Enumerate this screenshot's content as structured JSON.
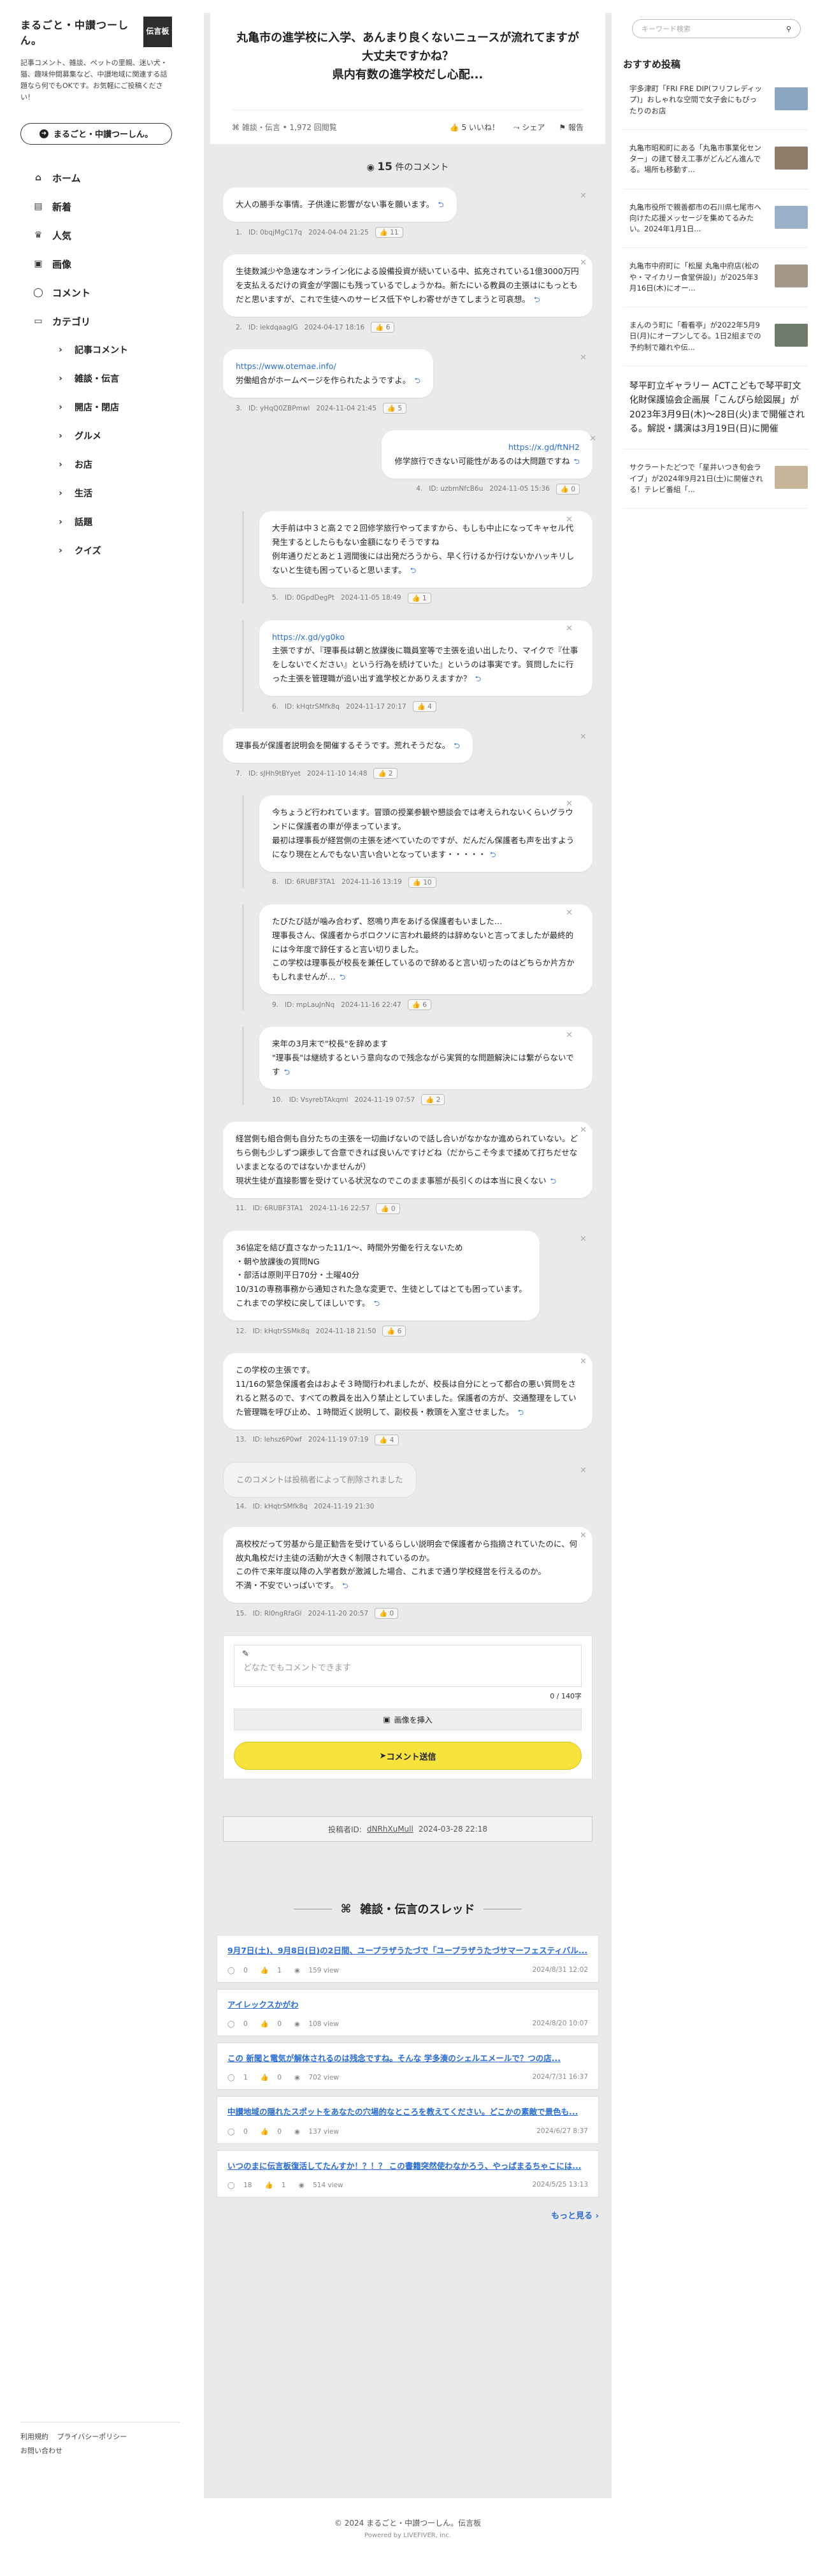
{
  "site": {
    "logo": "まるごと・中讃つーしん。",
    "badge": "伝言板",
    "description": "記事コメント、雑談、ペットの里親、迷い犬・猫、趣味仲間募集など、中讃地域に関連する話題なら何でもOKです。お気軽にご投稿ください！",
    "button_label": "まるごと・中讃つーしん。"
  },
  "nav": [
    {
      "label": "ホーム",
      "icon": "home-icon",
      "glyph": "⌂",
      "sub": false
    },
    {
      "label": "新着",
      "icon": "news-icon",
      "glyph": "▤",
      "sub": false
    },
    {
      "label": "人気",
      "icon": "popular-icon",
      "glyph": "♛",
      "sub": false
    },
    {
      "label": "画像",
      "icon": "image-icon",
      "glyph": "▣",
      "sub": false
    },
    {
      "label": "コメント",
      "icon": "comment-icon",
      "glyph": "◯",
      "sub": false
    },
    {
      "label": "カテゴリ",
      "icon": "folder-icon",
      "glyph": "▭",
      "sub": false
    },
    {
      "label": "記事コメント",
      "icon": "chevron-right-icon",
      "glyph": "›",
      "sub": true
    },
    {
      "label": "雑談・伝言",
      "icon": "chevron-right-icon",
      "glyph": "›",
      "sub": true
    },
    {
      "label": "開店・閉店",
      "icon": "chevron-right-icon",
      "glyph": "›",
      "sub": true
    },
    {
      "label": "グルメ",
      "icon": "chevron-right-icon",
      "glyph": "›",
      "sub": true
    },
    {
      "label": "お店",
      "icon": "chevron-right-icon",
      "glyph": "›",
      "sub": true
    },
    {
      "label": "生活",
      "icon": "chevron-right-icon",
      "glyph": "›",
      "sub": true
    },
    {
      "label": "話題",
      "icon": "chevron-right-icon",
      "glyph": "›",
      "sub": true
    },
    {
      "label": "クイズ",
      "icon": "chevron-right-icon",
      "glyph": "›",
      "sub": true
    }
  ],
  "footer": {
    "terms": "利用規約",
    "privacy": "プライバシーポリシー",
    "contact": "お問い合わせ"
  },
  "article": {
    "title": "丸亀市の進学校に入学、あんまり良くないニュースが流れてますが大丈夫ですかね？\n県内有数の進学校だし心配...",
    "category": "雑談・伝言 • 1,972 回閲覧",
    "like_label": "5 いいね！",
    "share_label": "シェア",
    "report_label": "報告"
  },
  "comment_count": {
    "num": "15",
    "label": "件のコメント"
  },
  "comments": [
    {
      "text": "大人の勝手な事情。子供達に影響がない事を願います。",
      "id": "ID: 0bqjMgC17q",
      "date": "2024-04-04 21:25",
      "likes": "11",
      "indent": false,
      "align": "left",
      "deleted": false
    },
    {
      "text": "生徒数減少や急速なオンライン化による設備投資が続いている中、拡充されている1億3000万円を支払えるだけの資金が学園にも残っているでしょうかね。新たにいる教員の主張はにもっともだと思いますが、これで生徒へのサービス低下やしわ寄せがきてしまうと可哀想。",
      "id": "ID: iekdqaagIG",
      "date": "2024-04-17 18:16",
      "likes": "6",
      "indent": false,
      "align": "left",
      "deleted": false
    },
    {
      "text_link": "https://www.otemae.info/",
      "text": "労働組合がホームページを作られたようですよ。",
      "id": "ID: yHqQ0ZBPmwl",
      "date": "2024-11-04 21:45",
      "likes": "5",
      "indent": false,
      "align": "left",
      "deleted": false
    },
    {
      "text_link": "https://x.gd/ftNH2",
      "text": "修学旅行できない可能性があるのは大問題ですね",
      "id": "ID: uzbmNfcB6u",
      "date": "2024-11-05 15:36",
      "likes": "0",
      "indent": false,
      "align": "right",
      "deleted": false
    },
    {
      "text": "大手前は中３と高２で２回修学旅行やってますから、もしも中止になってキャセル代発生するとしたらもない金額になりそうですね\n例年通りだとあと１週間後には出発だろうから、早く行けるか行けないかハッキリしないと生徒も困っていると思います。",
      "id": "ID: 0GpdDegPt",
      "date": "2024-11-05 18:49",
      "likes": "1",
      "indent": true,
      "align": "left",
      "deleted": false
    },
    {
      "text_link": "https://x.gd/yg0ko",
      "text": "主張ですが、『理事長は朝と放課後に職員室等で主張を追い出したり、マイクで『仕事をしないでください』という行為を続けていた』というのは事実です。質問したに行った主張を管理職が追い出す進学校とかありえますか？",
      "id": "ID: kHqtrSMfk8q",
      "date": "2024-11-17 20:17",
      "likes": "4",
      "indent": true,
      "align": "left",
      "deleted": false
    },
    {
      "text": "理事長が保護者説明会を開催するそうです。荒れそうだな。",
      "id": "ID: sJHh9tBYyet",
      "date": "2024-11-10 14:48",
      "likes": "2",
      "indent": false,
      "align": "left",
      "deleted": false
    },
    {
      "text": "今ちょうど行われています。冒頭の授業参観や懇談会では考えられないくらいグラウンドに保護者の車が停まっています。\n最初は理事長が経営側の主張を述べていたのですが、だんだん保護者も声を出すようになり現在とんでもない言い合いとなっています・・・・・",
      "id": "ID: 6RUBF3TA1",
      "date": "2024-11-16 13:19",
      "likes": "10",
      "indent": true,
      "align": "left",
      "deleted": false
    },
    {
      "text": "たびたび話が噛み合わず、怒鳴り声をあげる保護者もいました…\n理事長さん、保護者からボロクソに言われ最終的は辞めないと言ってましたが最終的には今年度で辞任すると言い切りました。\nこの学校は理事長が校長を兼任しているので辞めると言い切ったのはどちらか片方かもしれませんが…",
      "id": "ID: mpLauJnNq",
      "date": "2024-11-16 22:47",
      "likes": "6",
      "indent": true,
      "align": "left",
      "deleted": false
    },
    {
      "text": "来年の3月末で\"校長\"を辞めます\n\"理事長\"は継続するという意向なので残念ながら実質的な問題解決には繋がらないです",
      "id": "ID: VsyrebTAkqml",
      "date": "2024-11-19 07:57",
      "likes": "2",
      "indent": true,
      "align": "left",
      "deleted": false
    },
    {
      "text": "経営側も組合側も自分たちの主張を一切曲げないので話し合いがなかなか進められていない。どちら側も少しずつ譲歩して合意できれば良いんですけどね（だからこそ今まで揉めて打ちだせないままとなるのではないかませんが）\n現状生徒が直接影響を受けている状況なのでこのまま事態が長引くのは本当に良くない",
      "id": "ID: 6RUBF3TA1",
      "date": "2024-11-16 22:57",
      "likes": "0",
      "indent": false,
      "align": "left",
      "deleted": false
    },
    {
      "text": "36協定を結び直さなかった11/1～、時間外労働を行えないため\n・朝や放課後の質問NG\n・部活は原則平日70分・土曜40分\n10/31の専務事務から通知された急な変更で、生徒としてはとても困っています。\nこれまでの学校に戻してほしいです。",
      "id": "ID: kHqtrSSMk8q",
      "date": "2024-11-18 21:50",
      "likes": "6",
      "indent": false,
      "align": "left",
      "deleted": false
    },
    {
      "text": "この学校の主張です。\n11/16の緊急保護者会はおよそ３時間行われましたが、校長は自分にとって都合の悪い質問をされると黙るので、すべての教員を出入り禁止としていました。保護者の方が、交通整理をしていた管理職を呼び止め、１時間近く説明して、副校長・教頭を入室させました。",
      "id": "ID: lehsz6P0wf",
      "date": "2024-11-19 07:19",
      "likes": "4",
      "indent": false,
      "align": "left",
      "deleted": false
    },
    {
      "text": "このコメントは投稿者によって削除されました",
      "id": "ID: kHqtrSMfk8q",
      "date": "2024-11-19 21:30",
      "likes": "",
      "indent": false,
      "align": "left",
      "deleted": true
    },
    {
      "text": "高校校だって労基から是正勧告を受けているらしい説明会で保護者から指摘されていたのに、何故丸亀校だけ主徒の活動が大きく制限されているのか。\nこの件で来年度以降の入学者数が激減した場合、これまで通り学校経営を行えるのか。\n不満・不安でいっぱいです。",
      "id": "ID: Rl0ngRfaGl",
      "date": "2024-11-20 20:57",
      "likes": "0",
      "indent": false,
      "align": "left",
      "deleted": false
    }
  ],
  "form": {
    "placeholder": "どなたでもコメントできます",
    "char_count": "0 / 140字",
    "image_button": "画像を挿入",
    "submit_button": "コメント送信"
  },
  "poster": {
    "label": "投稿者ID:",
    "id": "dNRhXuMull",
    "date": "2024-03-28 22:18"
  },
  "threads_section": {
    "title": "雑談・伝言のスレッド",
    "more": "もっと見る",
    "items": [
      {
        "title": "9月7日(土)、9月8日(日)の2日間、ユープラザうたづで「ユープラザうたづサマーフェスティバル...",
        "comments": "0",
        "likes": "1",
        "views": "159 view",
        "date": "2024/8/31 12:02"
      },
      {
        "title": "アイレックスかがわ",
        "comments": "0",
        "likes": "0",
        "views": "108 view",
        "date": "2024/8/20 10:07"
      },
      {
        "title": "この 新聞と電気が解体されるのは残念ですね。そんな 学多湊のシェルエメールで？つの店...",
        "comments": "1",
        "likes": "0",
        "views": "702 view",
        "date": "2024/7/31 16:37"
      },
      {
        "title": "中讃地域の隠れたスポットをあなたの穴場的なところを教えてください。どこかの素敵で景色も...",
        "comments": "0",
        "likes": "0",
        "views": "137 view",
        "date": "2024/6/27 8:37"
      },
      {
        "title": "いつのまに伝言板復活してたんすか！？！？ この書籍突然使わなかろう、やっぱまるちゃこには...",
        "comments": "18",
        "likes": "1",
        "views": "514 view",
        "date": "2024/5/25 13:13"
      }
    ]
  },
  "copyright": {
    "text": "© 2024 まるごと・中讃つーしん。伝言板",
    "powered": "Powered by LIVEFIVER, inc."
  },
  "search": {
    "placeholder": "キーワード検索"
  },
  "recommend": {
    "heading": "おすすめ投稿",
    "items": [
      {
        "text": "宇多津町「FRI FRE DIP(フリフレディップ)」おしゃれな空間で女子会にもぴったりのお店",
        "thumb_color": "#8aa4c2",
        "big": false
      },
      {
        "text": "丸亀市昭和町にある「丸亀市事業化センター」の建て替え工事がどんどん進んでる。場所も移動す...",
        "thumb_color": "#8f7d6a",
        "big": false
      },
      {
        "text": "丸亀市役所で親善都市の石川県七尾市へ向けた応援メッセージを集めてるみたい。2024年1月1日...",
        "thumb_color": "#9bb0c6",
        "big": false
      },
      {
        "text": "丸亀市中府町に「松屋 丸亀中府店(松のや・マイカリー食堂併設)」が2025年3月16日(木)にオー...",
        "thumb_color": "#a39787",
        "big": false
      },
      {
        "text": "まんのう町に「看看亭」が2022年5月9日(月)にオープンしてる。1日2組までの予約制で離れや伝...",
        "thumb_color": "#6f7a6a",
        "big": false
      },
      {
        "text": "琴平町立ギャラリー ACTこどもで琴平町文化財保護協会企画展「こんぴら絵図展」が2023年3月9日(木)〜28日(火)まで開催される。解説・講演は3月19日(日)に開催",
        "thumb_color": "",
        "big": true
      },
      {
        "text": "サクラートたどつで「星井いつき旬会ライブ」が2024年9月21日(土)に開催される！テレビ番組「...",
        "thumb_color": "#c7b59a",
        "big": false
      }
    ]
  }
}
